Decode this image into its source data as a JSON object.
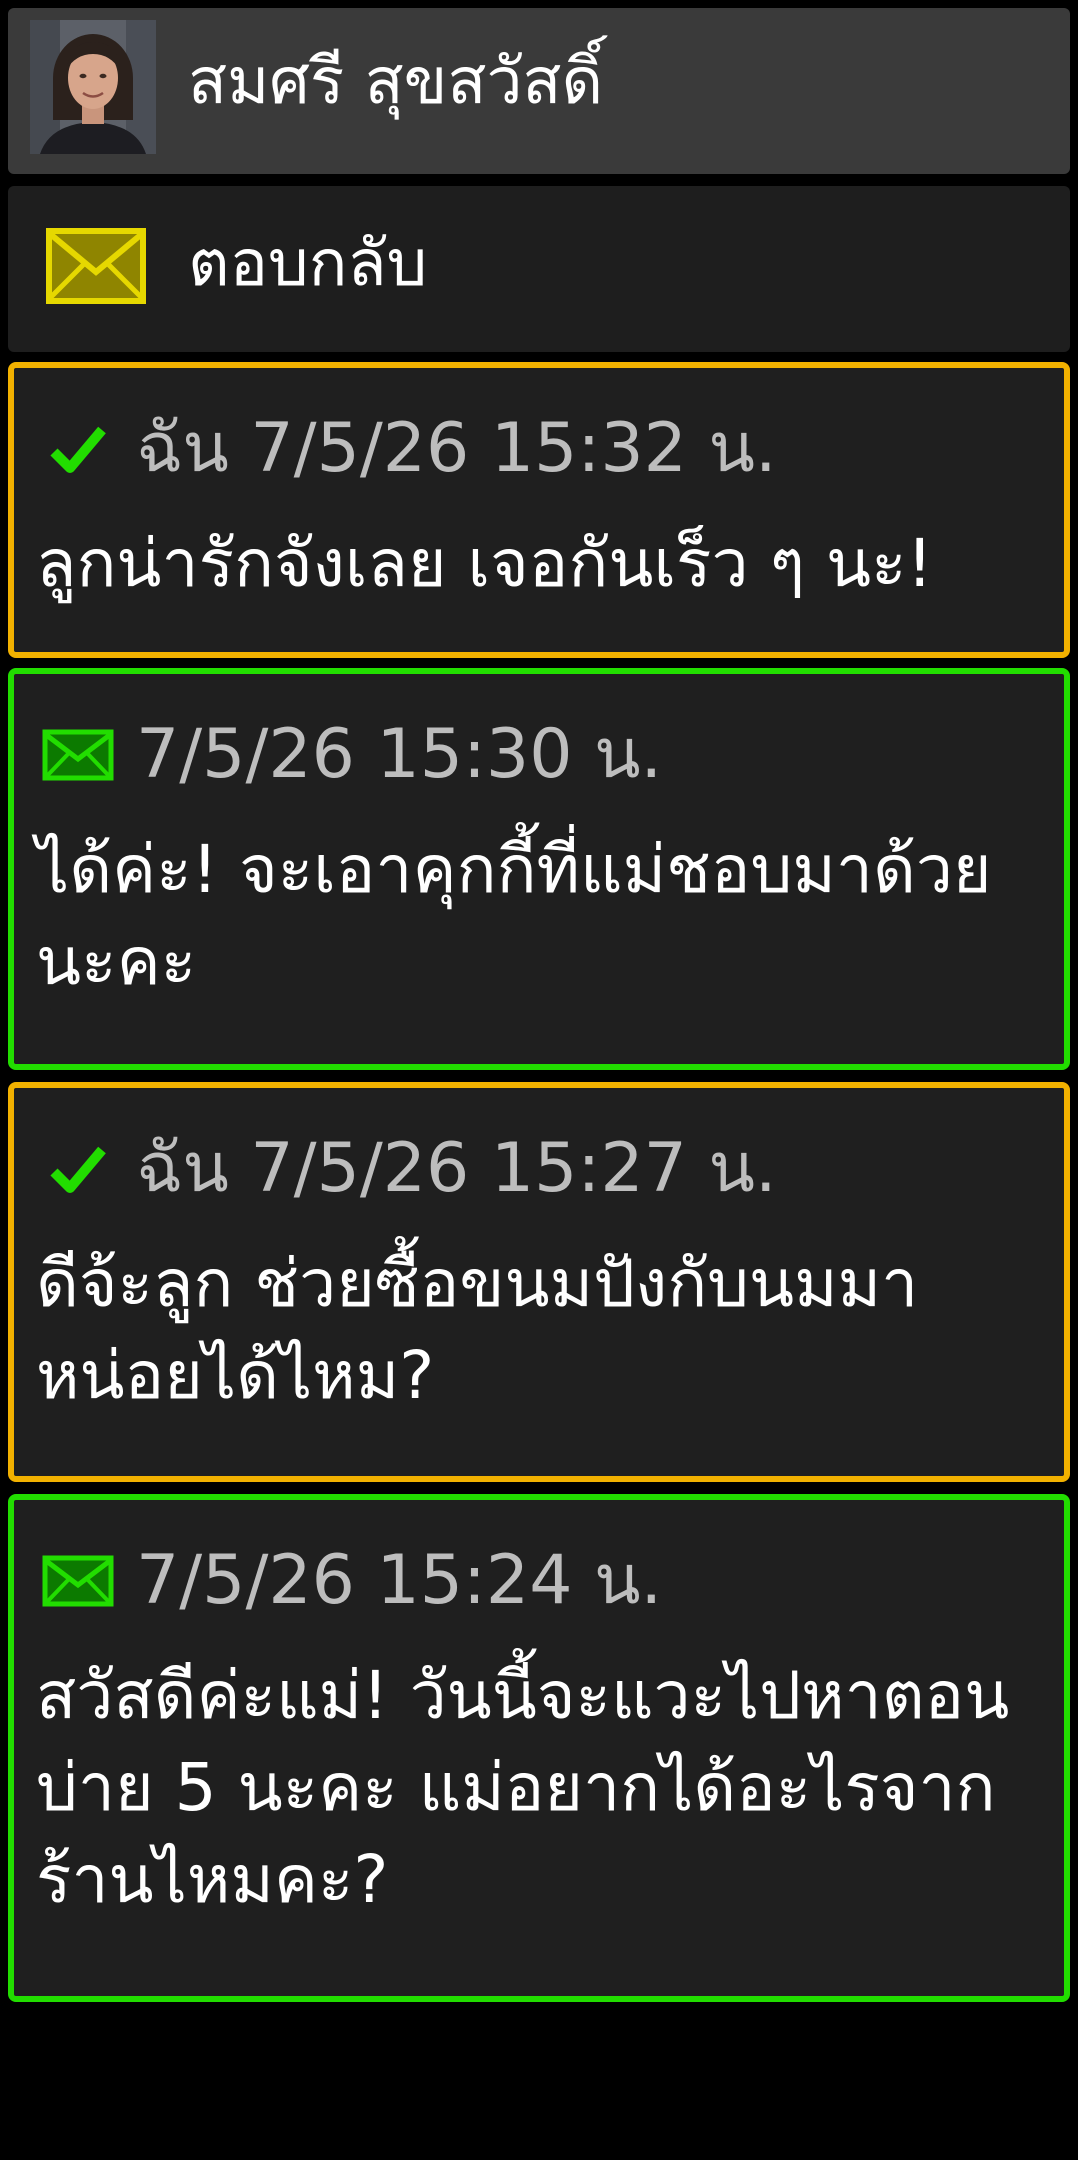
{
  "header": {
    "contact_name": "สมศรี สุขสวัสดิ์",
    "avatar": "contact-photo"
  },
  "reply": {
    "label": "ตอบกลับ",
    "icon": "envelope-icon",
    "icon_color": "#e6d800"
  },
  "messages": [
    {
      "direction": "sent",
      "status_icon": "checkmark-icon",
      "meta": "ฉัน 7/5/26 15:32 น.",
      "text": "ลูกน่ารักจังเลย เจอกันเร็ว ๆ นะ!",
      "border_color": "#f2b100"
    },
    {
      "direction": "received",
      "status_icon": "envelope-icon",
      "meta": "7/5/26 15:30 น.",
      "text": "ได้ค่ะ! จะเอาคุกกี้ที่แม่ชอบมาด้วยนะคะ",
      "border_color": "#22dd00"
    },
    {
      "direction": "sent",
      "status_icon": "checkmark-icon",
      "meta": "ฉัน 7/5/26 15:27 น.",
      "text": "ดีจ้ะลูก ช่วยซื้อขนมปังกับนมมาหน่อยได้ไหม?",
      "border_color": "#f2b100"
    },
    {
      "direction": "received",
      "status_icon": "envelope-icon",
      "meta": "7/5/26 15:24 น.",
      "text": "สวัสดีค่ะแม่! วันนี้จะแวะไปหาตอนบ่าย 5 นะคะ แม่อยากได้อะไรจากร้านไหมคะ?",
      "border_color": "#22dd00"
    }
  ],
  "colors": {
    "sent_border": "#f2b100",
    "received_border": "#22dd00",
    "check": "#22dd00",
    "received_envelope": "#22dd00",
    "meta_text": "#bdbdbd"
  }
}
